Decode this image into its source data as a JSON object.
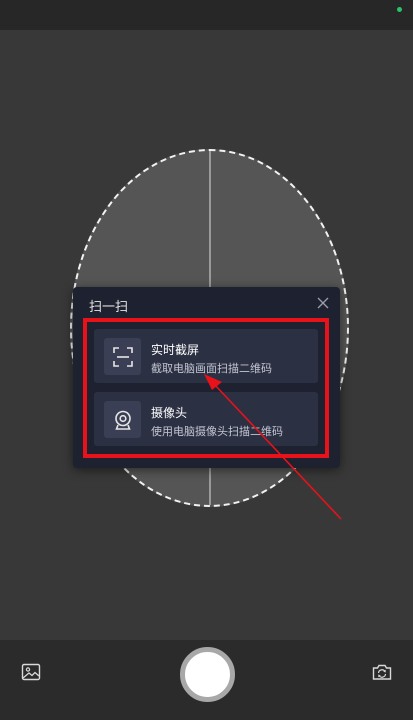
{
  "panel": {
    "title": "扫一扫",
    "options": [
      {
        "title": "实时截屏",
        "description": "截取电脑画面扫描二维码",
        "icon": "scan-frame-icon"
      },
      {
        "title": "摄像头",
        "description": "使用电脑摄像头扫描二维码",
        "icon": "webcam-icon"
      }
    ]
  },
  "icons": {
    "close": "close-icon",
    "gallery": "image-gallery-icon",
    "switch_camera": "switch-camera-icon"
  },
  "colors": {
    "highlight": "#e8121a",
    "panel_bg": "#1e2130",
    "option_bg": "#2c3043",
    "status_dot": "#27c46a"
  }
}
